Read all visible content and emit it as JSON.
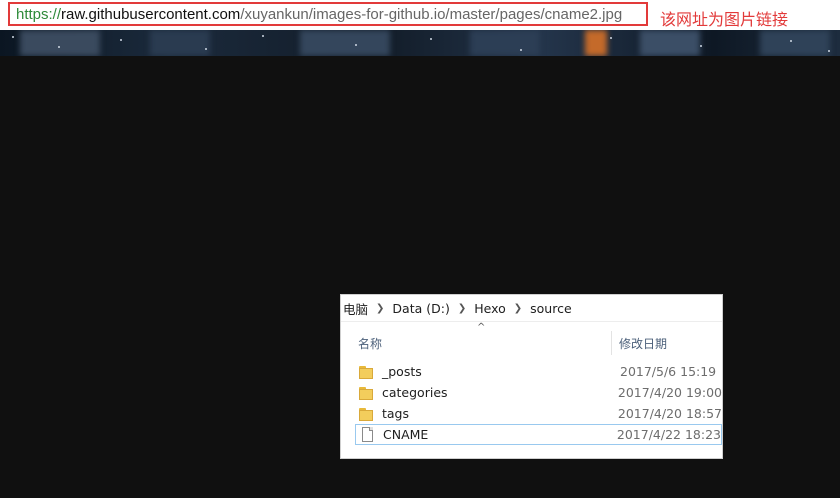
{
  "address_bar": {
    "url_scheme": "https://",
    "url_host": "raw.githubusercontent.com",
    "url_path": "/xuyankun/images-for-github.io/master/pages/cname2.jpg",
    "annotation": "该网址为图片链接",
    "highlight_color": "#e23a3a"
  },
  "explorer": {
    "breadcrumbs": [
      "电脑",
      "Data (D:)",
      "Hexo",
      "source"
    ],
    "sort_indicator": "^",
    "columns": {
      "name": "名称",
      "date": "修改日期"
    },
    "items": [
      {
        "icon": "folder-icon",
        "name": "_posts",
        "date": "2017/5/6 15:19"
      },
      {
        "icon": "folder-icon",
        "name": "categories",
        "date": "2017/4/20 19:00"
      },
      {
        "icon": "folder-icon",
        "name": "tags",
        "date": "2017/4/20 18:57"
      },
      {
        "icon": "file-icon",
        "name": "CNAME",
        "date": "2017/4/22 18:23"
      }
    ]
  }
}
